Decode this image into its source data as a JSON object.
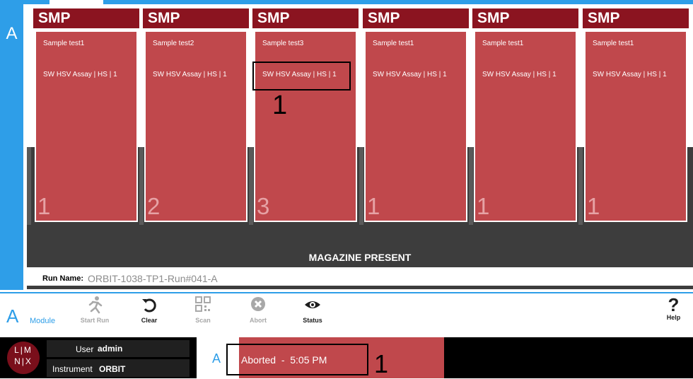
{
  "module": {
    "letter": "A"
  },
  "cartridges": [
    {
      "title": "SMP",
      "sample": "Sample test1",
      "assay": "SW HSV Assay | HS | 1",
      "number": "1"
    },
    {
      "title": "SMP",
      "sample": "Sample test2",
      "assay": "SW HSV Assay | HS | 1",
      "number": "2"
    },
    {
      "title": "SMP",
      "sample": "Sample test3",
      "assay": "SW HSV Assay | HS | 1",
      "number": "3"
    },
    {
      "title": "SMP",
      "sample": "Sample test1",
      "assay": "SW HSV Assay | HS | 1",
      "number": "1"
    },
    {
      "title": "SMP",
      "sample": "Sample test1",
      "assay": "SW HSV Assay | HS | 1",
      "number": "1"
    },
    {
      "title": "SMP",
      "sample": "Sample test1",
      "assay": "SW HSV Assay | HS | 1",
      "number": "1"
    }
  ],
  "magazine_status": "MAGAZINE PRESENT",
  "run": {
    "label": "Run Name:",
    "value": "ORBIT-1038-TP1-Run#041-A"
  },
  "annotations": {
    "callout_1": "1",
    "callout_2": "1"
  },
  "toolbar": {
    "module_letter": "A",
    "module_label": "Module",
    "buttons": [
      {
        "label": "Start Run",
        "icon": "run-icon",
        "enabled": false
      },
      {
        "label": "Clear",
        "icon": "undo-icon",
        "enabled": true
      },
      {
        "label": "Scan",
        "icon": "qr-code-icon",
        "enabled": false
      },
      {
        "label": "Abort",
        "icon": "close-circle-icon",
        "enabled": false
      },
      {
        "label": "Status",
        "icon": "eye-icon",
        "enabled": true
      }
    ],
    "help_label": "Help"
  },
  "statusbar": {
    "user_label": "User",
    "user_value": "admin",
    "instrument_label": "Instrument",
    "instrument_value": "ORBIT",
    "module_letter": "A",
    "status_text": "Aborted  -  5:05 PM"
  },
  "colors": {
    "accent_blue": "#2e9ee8",
    "cartridge_red": "#c0484c",
    "header_dark_red": "#8b1420"
  }
}
